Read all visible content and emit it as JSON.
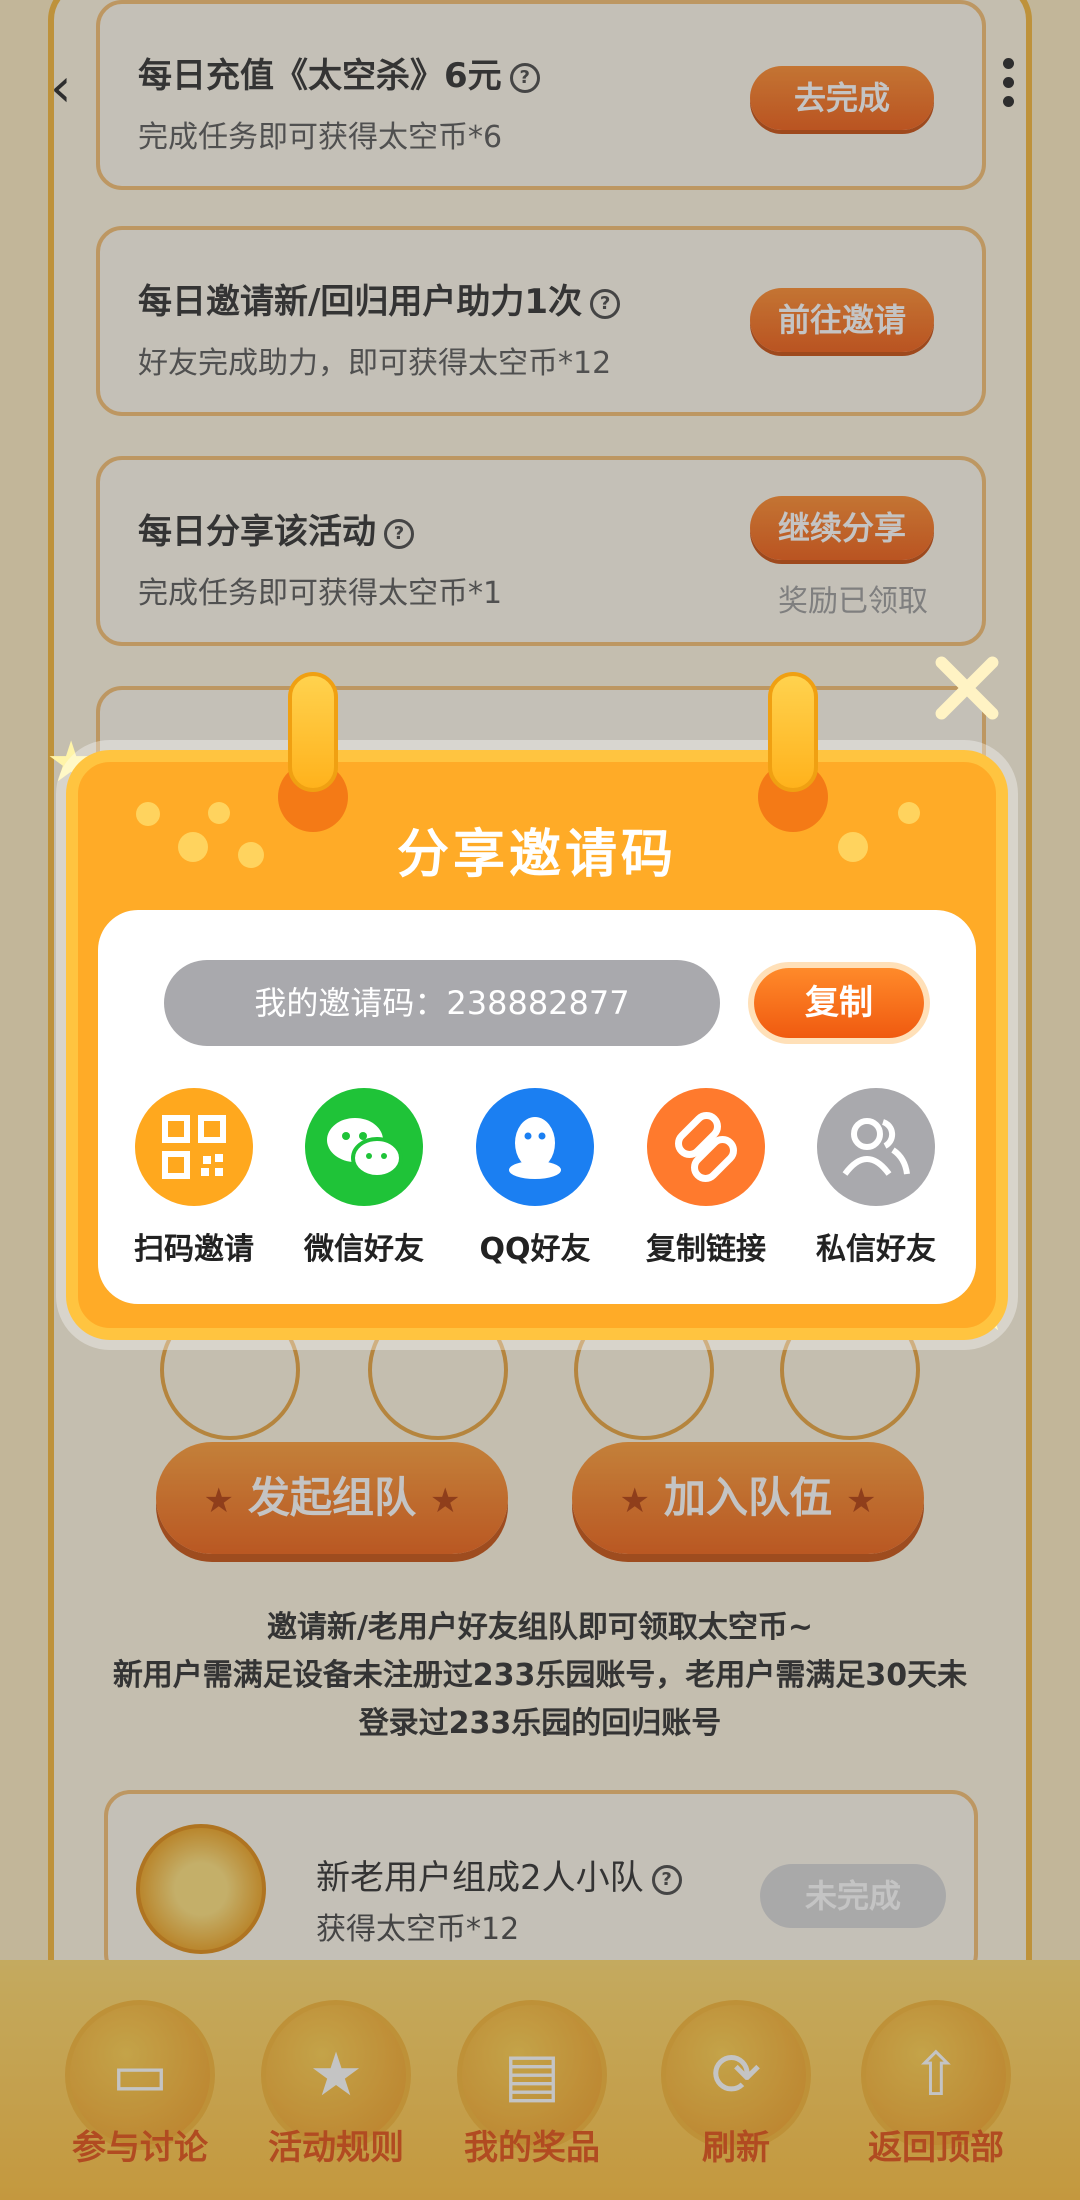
{
  "tasks": [
    {
      "title": "每日充值《太空杀》6元",
      "desc": "完成任务即可获得太空币*6",
      "button": "去完成",
      "sub": ""
    },
    {
      "title": "每日邀请新/回归用户助力1次",
      "desc": "好友完成助力，即可获得太空币*12",
      "button": "前往邀请",
      "sub": ""
    },
    {
      "title": "每日分享该活动",
      "desc": "完成任务即可获得太空币*1",
      "button": "继续分享",
      "sub": "奖励已领取"
    }
  ],
  "team": {
    "start_label": "发起组队",
    "join_label": "加入队伍",
    "info_lines": [
      "邀请新/老用户好友组队即可领取太空币~",
      "新用户需满足设备未注册过233乐园账号，老用户需满足30天未",
      "登录过233乐园的回归账号"
    ],
    "card_title": "新老用户组成2人小队",
    "card_desc": "获得太空币*12",
    "card_button": "未完成"
  },
  "bottom_nav": [
    {
      "label": "参与讨论",
      "icon": "chat-icon"
    },
    {
      "label": "活动规则",
      "icon": "star-icon"
    },
    {
      "label": "我的奖品",
      "icon": "gift-icon"
    },
    {
      "label": "刷新",
      "icon": "refresh-icon"
    },
    {
      "label": "返回顶部",
      "icon": "upload-icon"
    }
  ],
  "modal": {
    "title": "分享邀请码",
    "invite_code_label": "我的邀请码：238882877",
    "copy_label": "复制",
    "share_options": [
      {
        "label": "扫码邀请",
        "icon": "qrcode-icon",
        "color": "#ffa81e"
      },
      {
        "label": "微信好友",
        "icon": "wechat-icon",
        "color": "#1fc338"
      },
      {
        "label": "QQ好友",
        "icon": "qq-icon",
        "color": "#1b7ff2"
      },
      {
        "label": "复制链接",
        "icon": "link-icon",
        "color": "#ff7a2d"
      },
      {
        "label": "私信好友",
        "icon": "friends-icon",
        "color": "#a9a9ad"
      }
    ]
  },
  "colors": {
    "accent_orange": "#f05a10",
    "modal_yellow": "#ffab27",
    "page_bg": "#fcebc0"
  }
}
